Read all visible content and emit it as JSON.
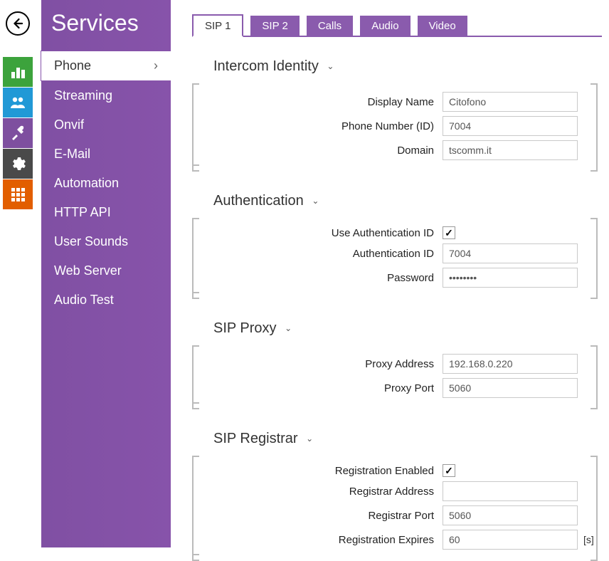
{
  "icon_tiles": [
    {
      "name": "chart-icon",
      "color": "tile-green"
    },
    {
      "name": "users-icon",
      "color": "tile-blue"
    },
    {
      "name": "tools-icon",
      "color": "tile-purple"
    },
    {
      "name": "gear-icon",
      "color": "tile-gray"
    },
    {
      "name": "grid-icon",
      "color": "tile-orange"
    }
  ],
  "sidebar": {
    "title": "Services",
    "items": [
      {
        "label": "Phone",
        "active": true
      },
      {
        "label": "Streaming",
        "active": false
      },
      {
        "label": "Onvif",
        "active": false
      },
      {
        "label": "E-Mail",
        "active": false
      },
      {
        "label": "Automation",
        "active": false
      },
      {
        "label": "HTTP API",
        "active": false
      },
      {
        "label": "User Sounds",
        "active": false
      },
      {
        "label": "Web Server",
        "active": false
      },
      {
        "label": "Audio Test",
        "active": false
      }
    ]
  },
  "tabs": [
    {
      "label": "SIP 1",
      "active": true
    },
    {
      "label": "SIP 2",
      "active": false
    },
    {
      "label": "Calls",
      "active": false
    },
    {
      "label": "Audio",
      "active": false
    },
    {
      "label": "Video",
      "active": false
    }
  ],
  "sections": {
    "identity": {
      "title": "Intercom Identity",
      "display_name_label": "Display Name",
      "display_name_value": "Citofono",
      "phone_number_label": "Phone Number (ID)",
      "phone_number_value": "7004",
      "domain_label": "Domain",
      "domain_value": "tscomm.it"
    },
    "auth": {
      "title": "Authentication",
      "use_auth_id_label": "Use Authentication ID",
      "use_auth_id_checked": true,
      "auth_id_label": "Authentication ID",
      "auth_id_value": "7004",
      "password_label": "Password",
      "password_value": "••••••••"
    },
    "proxy": {
      "title": "SIP Proxy",
      "address_label": "Proxy Address",
      "address_value": "192.168.0.220",
      "port_label": "Proxy Port",
      "port_value": "5060"
    },
    "registrar": {
      "title": "SIP Registrar",
      "enabled_label": "Registration Enabled",
      "enabled_checked": true,
      "address_label": "Registrar Address",
      "address_value": "",
      "port_label": "Registrar Port",
      "port_value": "5060",
      "expires_label": "Registration Expires",
      "expires_value": "60",
      "expires_unit": "[s]"
    }
  }
}
